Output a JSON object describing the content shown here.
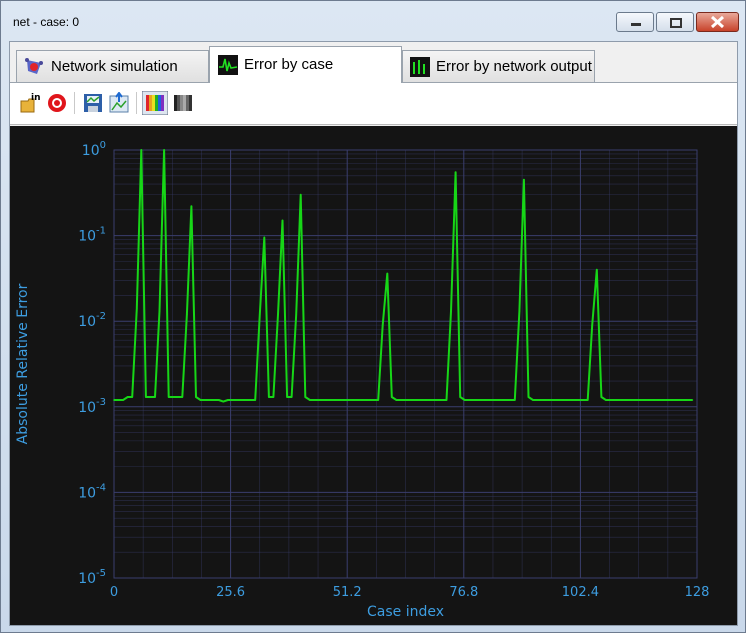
{
  "window": {
    "title": "net - case: 0"
  },
  "tabs": [
    {
      "label": "Network simulation",
      "icon": "network-icon",
      "active": false
    },
    {
      "label": "Error by case",
      "icon": "waveform-icon",
      "active": true
    },
    {
      "label": "Error by network output",
      "icon": "bars-icon",
      "active": false
    }
  ],
  "toolbar": {
    "icons": [
      "open-in-icon",
      "record-icon",
      "save-image-icon",
      "export-image-icon",
      "color-palette-icon",
      "grayscale-palette-icon"
    ]
  },
  "colors": {
    "background": "#141414",
    "grid": "#3a3e6e",
    "line": "#17d617",
    "axis_text": "#3d9de0"
  },
  "chart_data": {
    "type": "line",
    "title": "",
    "xlabel": "Case index",
    "ylabel": "Absolute Relative Error",
    "xlim": [
      0,
      128
    ],
    "ylim": [
      1e-05,
      1
    ],
    "yscale": "log",
    "grid": true,
    "x_ticks": [
      "0",
      "25.6",
      "51.2",
      "76.8",
      "102.4",
      "128"
    ],
    "y_ticks": [
      {
        "base": "10",
        "exp": "0",
        "value": 1
      },
      {
        "base": "10",
        "exp": "-1",
        "value": 0.1
      },
      {
        "base": "10",
        "exp": "-2",
        "value": 0.01
      },
      {
        "base": "10",
        "exp": "-3",
        "value": 0.001
      },
      {
        "base": "10",
        "exp": "-4",
        "value": 0.0001
      },
      {
        "base": "10",
        "exp": "-5",
        "value": 1e-05
      }
    ],
    "series": [
      {
        "x": [
          0,
          1,
          2,
          3,
          4,
          5,
          6,
          7,
          8,
          9,
          10,
          11,
          12,
          13,
          14,
          15,
          16,
          17,
          18,
          19,
          20,
          21,
          22,
          23,
          24,
          25,
          26,
          27,
          28,
          29,
          30,
          31,
          32,
          33,
          34,
          35,
          36,
          37,
          38,
          39,
          40,
          41,
          42,
          43,
          44,
          45,
          46,
          47,
          48,
          49,
          50,
          51,
          52,
          53,
          54,
          55,
          56,
          57,
          58,
          59,
          60,
          61,
          62,
          63,
          64,
          65,
          66,
          67,
          68,
          69,
          70,
          71,
          72,
          73,
          74,
          75,
          76,
          77,
          78,
          79,
          80,
          81,
          82,
          83,
          84,
          85,
          86,
          87,
          88,
          89,
          90,
          91,
          92,
          93,
          94,
          95,
          96,
          97,
          98,
          99,
          100,
          101,
          102,
          103,
          104,
          105,
          106,
          107,
          108,
          109,
          110,
          111,
          112,
          113,
          114,
          115,
          116,
          117,
          118,
          119,
          120,
          121,
          122,
          123,
          124,
          125,
          126,
          127
        ],
        "y": [
          0.0012,
          0.0012,
          0.0012,
          0.0013,
          0.0013,
          0.014,
          1.0,
          0.0013,
          0.0013,
          0.0013,
          0.013,
          1.0,
          0.0013,
          0.0013,
          0.0013,
          0.0013,
          0.012,
          0.22,
          0.0013,
          0.0012,
          0.0012,
          0.0012,
          0.0012,
          0.0012,
          0.00115,
          0.0012,
          0.0012,
          0.0012,
          0.0012,
          0.0012,
          0.0012,
          0.0012,
          0.012,
          0.095,
          0.0013,
          0.0013,
          0.012,
          0.15,
          0.0013,
          0.0013,
          0.012,
          0.3,
          0.0013,
          0.0012,
          0.0012,
          0.0012,
          0.0012,
          0.0012,
          0.0012,
          0.0012,
          0.0012,
          0.0012,
          0.0012,
          0.0012,
          0.0012,
          0.0012,
          0.0012,
          0.0012,
          0.0012,
          0.009,
          0.036,
          0.0013,
          0.0012,
          0.0012,
          0.0012,
          0.0012,
          0.0012,
          0.0012,
          0.0012,
          0.0012,
          0.0012,
          0.0012,
          0.0012,
          0.0012,
          0.013,
          0.55,
          0.0013,
          0.0012,
          0.0012,
          0.0012,
          0.0012,
          0.0012,
          0.0012,
          0.0012,
          0.0012,
          0.0012,
          0.0012,
          0.0012,
          0.0012,
          0.013,
          0.45,
          0.0013,
          0.0012,
          0.0012,
          0.0012,
          0.0012,
          0.0012,
          0.0012,
          0.0012,
          0.0012,
          0.0012,
          0.0012,
          0.0012,
          0.0012,
          0.0012,
          0.009,
          0.04,
          0.0013,
          0.0012,
          0.0012,
          0.0012,
          0.0012,
          0.0012,
          0.0012,
          0.0012,
          0.0012,
          0.0012,
          0.0012,
          0.0012,
          0.0012,
          0.0012,
          0.0012,
          0.0012,
          0.0012,
          0.0012,
          0.0012,
          0.0012,
          0.0012
        ]
      }
    ]
  }
}
